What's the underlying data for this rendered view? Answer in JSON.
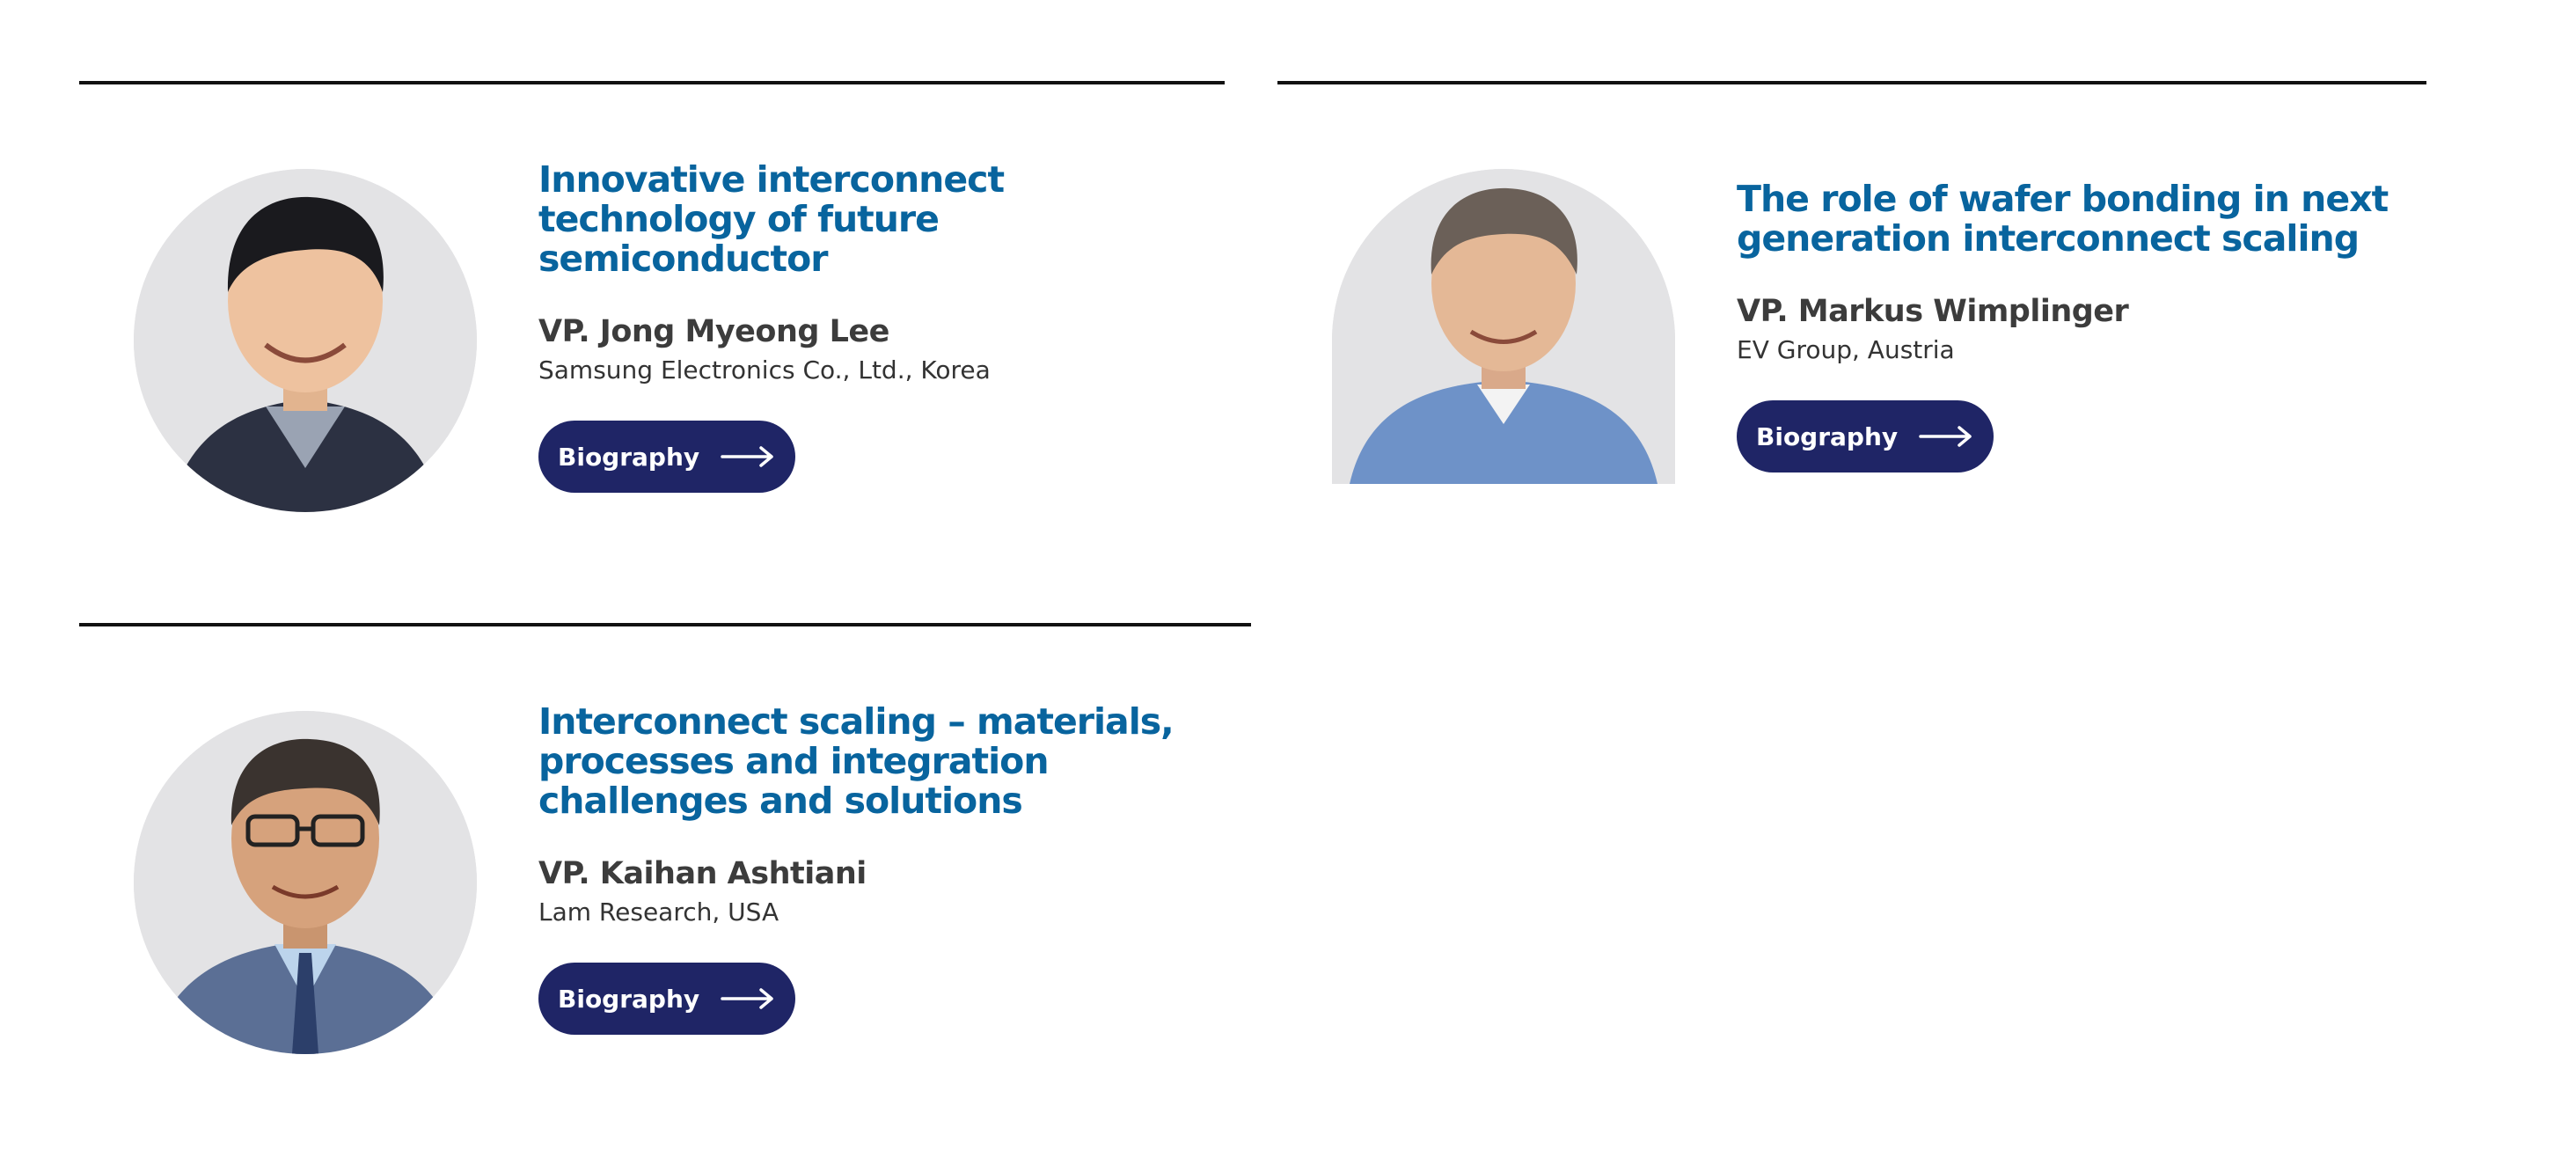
{
  "speakers": [
    {
      "title": "Innovative interconnect technology of future semiconductor",
      "name": "VP. Jong Myeong Lee",
      "org": "Samsung Electronics Co., Ltd., Korea",
      "button_label": "Biography",
      "button_icon": "arrow-right-icon"
    },
    {
      "title": "The role of wafer bonding in next generation interconnect scaling",
      "name": "VP. Markus Wimplinger",
      "org": "EV Group, Austria",
      "button_label": "Biography",
      "button_icon": "arrow-right-icon"
    },
    {
      "title": "Interconnect scaling – materials, processes and integration challenges and solutions",
      "name": "VP. Kaihan Ashtiani",
      "org": "Lam Research, USA",
      "button_label": "Biography",
      "button_icon": "arrow-right-icon"
    }
  ],
  "colors": {
    "title": "#08649e",
    "button": "#1f2566",
    "name": "#3c3c3c",
    "rule": "#111111",
    "avatar_bg": "#e3e3e5"
  }
}
